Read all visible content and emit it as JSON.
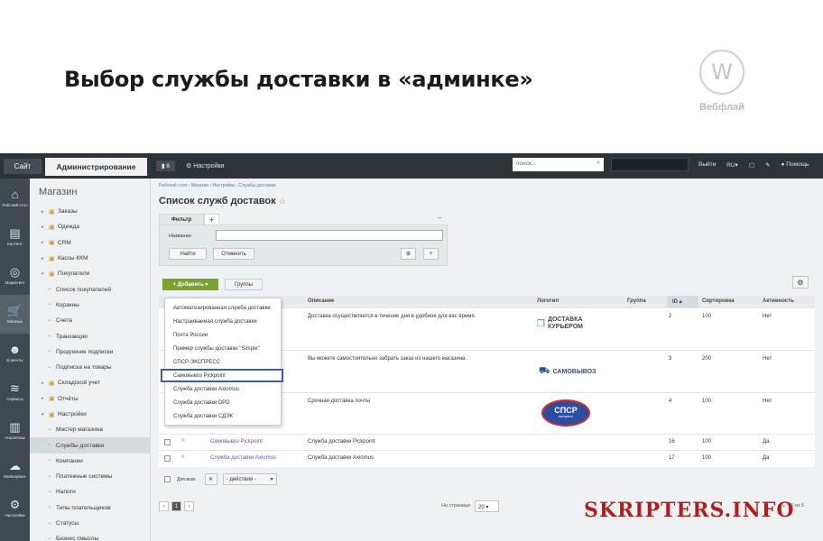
{
  "slide": {
    "title": "Выбор службы доставки в «админке»",
    "logo_letter": "W",
    "logo_text": "Вебфлай"
  },
  "topbar": {
    "site": "Сайт",
    "admin": "Администрирование",
    "notif_count": "6",
    "settings": "Настройки",
    "search_placeholder": "поиск...",
    "right": [
      "Выйти",
      "RU",
      "Помощь"
    ]
  },
  "sidebar": [
    {
      "icon": "home-icon",
      "glyph": "⌂",
      "label": "Рабочий стол"
    },
    {
      "icon": "content-icon",
      "glyph": "▤",
      "label": "Контент"
    },
    {
      "icon": "marketing-icon",
      "glyph": "◎",
      "label": "Маркетинг"
    },
    {
      "icon": "cart-icon",
      "glyph": "🛒",
      "label": "Магазин"
    },
    {
      "icon": "clients-icon",
      "glyph": "☻",
      "label": "Клиенты"
    },
    {
      "icon": "services-icon",
      "glyph": "≋",
      "label": "Сервисы"
    },
    {
      "icon": "analytics-icon",
      "glyph": "▥",
      "label": "Аналитика"
    },
    {
      "icon": "marketplace-icon",
      "glyph": "☁",
      "label": "Marketplace"
    },
    {
      "icon": "settings-icon",
      "glyph": "⚙",
      "label": "Настройки"
    }
  ],
  "menu": {
    "title": "Магазин",
    "items": [
      {
        "label": "Заказы",
        "level": 0
      },
      {
        "label": "Одежда",
        "level": 0
      },
      {
        "label": "CRM",
        "level": 0
      },
      {
        "label": "Кассы ККМ",
        "level": 0
      },
      {
        "label": "Покупатели",
        "level": 0
      },
      {
        "label": "Список покупателей",
        "level": 1
      },
      {
        "label": "Корзины",
        "level": 1
      },
      {
        "label": "Счета",
        "level": 1
      },
      {
        "label": "Транзакции",
        "level": 1
      },
      {
        "label": "Продление подписки",
        "level": 1
      },
      {
        "label": "Подписка на товары",
        "level": 1
      },
      {
        "label": "Складской учет",
        "level": 0
      },
      {
        "label": "Отчёты",
        "level": 0
      },
      {
        "label": "Настройки",
        "level": 0
      },
      {
        "label": "Мастер магазина",
        "level": 1
      },
      {
        "label": "Службы доставки",
        "level": 1
      },
      {
        "label": "Компании",
        "level": 1
      },
      {
        "label": "Платежные системы",
        "level": 1
      },
      {
        "label": "Налоги",
        "level": 1
      },
      {
        "label": "Типы плательщиков",
        "level": 1
      },
      {
        "label": "Статусы",
        "level": 1
      },
      {
        "label": "Бизнес смыслы",
        "level": 1
      }
    ]
  },
  "content": {
    "breadcrumb": "Рабочий стол  ›  Магазин  ›  Настройки  ›  Службы доставки",
    "title": "Список служб доставок",
    "filter": {
      "tab": "Фильтр",
      "name_label": "Название:",
      "find": "Найти",
      "cancel": "Отменить"
    },
    "add_button": "Добавить",
    "groups_button": "Группы",
    "columns": {
      "description": "Описание",
      "logo": "Логотип",
      "group": "Группа",
      "id": "ID",
      "sort": "Сортировка",
      "active": "Активность"
    },
    "rows": [
      {
        "name": "",
        "description": "Доставка осуществляется в течение дня в удобное для вас время.",
        "logo": "ДОСТАВКА КУРЬЕРОМ",
        "id": "2",
        "sort": "100",
        "active": "Нет"
      },
      {
        "name": "",
        "description": "Вы можете самостоятельно забрать заказ из нашего магазина.",
        "logo": "САМОВЫВОЗ",
        "id": "3",
        "sort": "200",
        "active": "Нет"
      },
      {
        "name": "",
        "description": "Срочная доставка почты",
        "logo": "СПСР",
        "id": "4",
        "sort": "100",
        "active": "Нет"
      },
      {
        "name": "Самовывоз Pickpoint",
        "description": "Служба доставки Pickpoint",
        "logo": "",
        "id": "16",
        "sort": "100",
        "active": "Да"
      },
      {
        "name": "Служба доставки Axiomus",
        "description": "Служба доставки Axiomus",
        "logo": "",
        "id": "17",
        "sort": "100",
        "active": "Да"
      }
    ],
    "footer": {
      "for_all": "Для всех",
      "actions": "- действия -",
      "per_page": "На странице",
      "per_page_value": "20",
      "count": "1 – 5 из 5",
      "page": "1"
    },
    "dropdown": [
      "Автоматизированная служба доставки",
      "Настраиваемая служба доставки",
      "Почта России",
      "Пример службы доставки \"Simple\"",
      "СПСР-ЭКСПРЕСС",
      "Самовывоз Pickpoint",
      "Служба доставки Axiomus",
      "Служба доставки DPD",
      "Служба доставки СДЭК"
    ],
    "dropdown_highlight": 5
  },
  "watermark": "SKRIPTERS.INFO",
  "colors": {
    "topbar": "#2c3438",
    "sidebar": "#3e4a50",
    "add_button": "#7aa32c",
    "highlight": "#3d5bb5",
    "watermark": "#b51d1d"
  }
}
